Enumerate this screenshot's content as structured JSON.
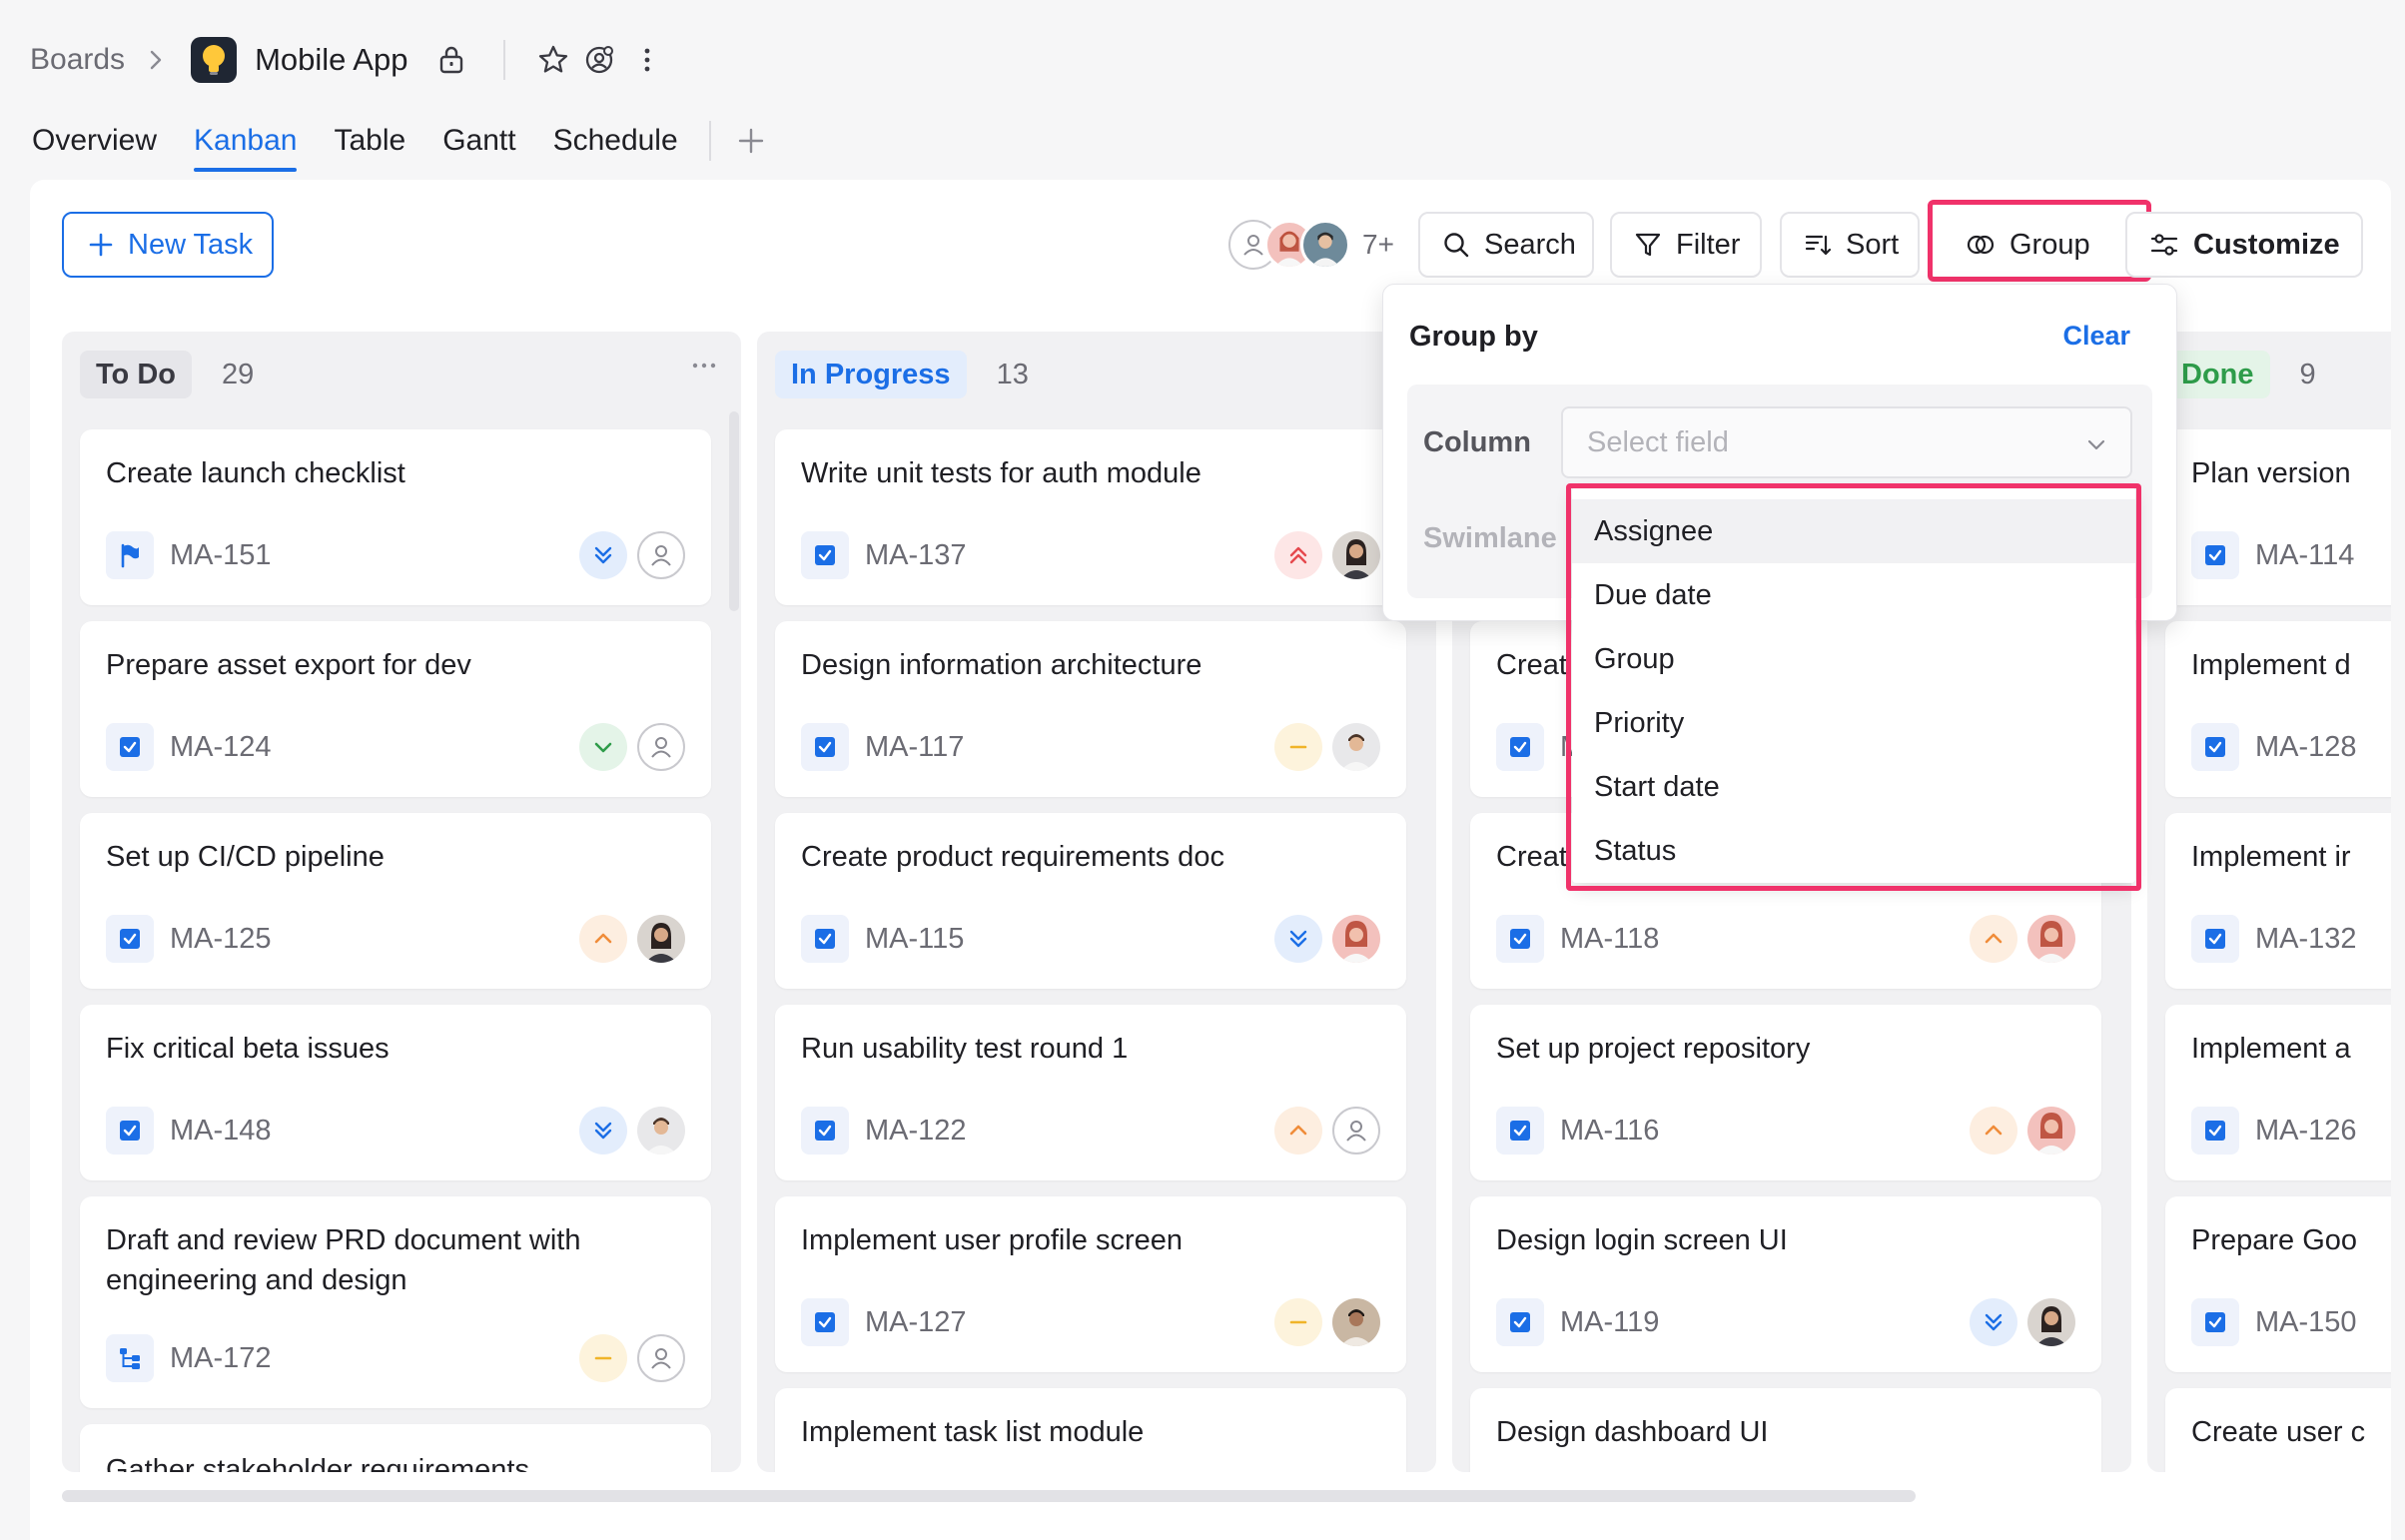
{
  "breadcrumb": {
    "root": "Boards",
    "app_name": "Mobile App"
  },
  "tabs": [
    "Overview",
    "Kanban",
    "Table",
    "Gantt",
    "Schedule"
  ],
  "active_tab": "Kanban",
  "toolbar": {
    "new_task": "New Task",
    "members_more": "7+",
    "search": "Search",
    "filter": "Filter",
    "sort": "Sort",
    "group": "Group",
    "customize": "Customize"
  },
  "columns": [
    {
      "name": "To Do",
      "count": "29",
      "accent": "#3a3a42",
      "chip_bg": "#e6e6ea",
      "cards": [
        {
          "title": "Create launch checklist",
          "id": "MA-151",
          "type": "flag",
          "priority": "lowest",
          "assignee": "none"
        },
        {
          "title": "Prepare asset export for dev",
          "id": "MA-124",
          "type": "task",
          "priority": "low",
          "assignee": "none"
        },
        {
          "title": "Set up CI/CD pipeline",
          "id": "MA-125",
          "type": "task",
          "priority": "high",
          "assignee": "woman-dark"
        },
        {
          "title": "Fix critical beta issues",
          "id": "MA-148",
          "type": "task",
          "priority": "lowest",
          "assignee": "man-light"
        },
        {
          "title": "Draft and review PRD document with engineering and design",
          "id": "MA-172",
          "type": "subtask",
          "priority": "medium",
          "assignee": "none"
        },
        {
          "title": "Gather stakeholder requirements",
          "id": "",
          "type": "task",
          "priority": "",
          "assignee": ""
        }
      ]
    },
    {
      "name": "In Progress",
      "count": "13",
      "accent": "#1b6ee6",
      "chip_bg": "#e3edfc",
      "cards": [
        {
          "title": "Write unit tests for auth module",
          "id": "MA-137",
          "type": "task",
          "priority": "highest",
          "assignee": "woman-dark"
        },
        {
          "title": "Design information architecture",
          "id": "MA-117",
          "type": "task",
          "priority": "medium",
          "assignee": "man-light"
        },
        {
          "title": "Create product requirements doc",
          "id": "MA-115",
          "type": "task",
          "priority": "lowest",
          "assignee": "woman-red"
        },
        {
          "title": "Run usability test round 1",
          "id": "MA-122",
          "type": "task",
          "priority": "high",
          "assignee": "none"
        },
        {
          "title": "Implement user profile screen",
          "id": "MA-127",
          "type": "task",
          "priority": "medium",
          "assignee": "man-dark"
        },
        {
          "title": "Implement task list module",
          "id": "",
          "type": "task",
          "priority": "",
          "assignee": ""
        }
      ]
    },
    {
      "name": "",
      "count": "",
      "accent": "#1f1f24",
      "chip_bg": "#ffffff",
      "cards": [
        {
          "title": "",
          "id": "",
          "type": "task",
          "priority": "",
          "assignee": ""
        },
        {
          "title": "Creat",
          "id": "M",
          "type": "task",
          "priority": "",
          "assignee": ""
        },
        {
          "title": "Creat",
          "id": "MA-118",
          "type": "task",
          "priority": "high",
          "assignee": "woman-red"
        },
        {
          "title": "Set up project repository",
          "id": "MA-116",
          "type": "task",
          "priority": "high",
          "assignee": "woman-red"
        },
        {
          "title": "Design login screen UI",
          "id": "MA-119",
          "type": "task",
          "priority": "lowest",
          "assignee": "woman-dark"
        },
        {
          "title": "Design dashboard UI",
          "id": "",
          "type": "task",
          "priority": "",
          "assignee": ""
        }
      ]
    },
    {
      "name": "Done",
      "count": "9",
      "accent": "#2e9c4a",
      "chip_bg": "#e4f4e8",
      "cards": [
        {
          "title": "Plan version",
          "id": "MA-114",
          "type": "task",
          "priority": "",
          "assignee": ""
        },
        {
          "title": "Implement d",
          "id": "MA-128",
          "type": "task",
          "priority": "",
          "assignee": ""
        },
        {
          "title": "Implement ir",
          "id": "MA-132",
          "type": "task",
          "priority": "",
          "assignee": ""
        },
        {
          "title": "Implement a",
          "id": "MA-126",
          "type": "task",
          "priority": "",
          "assignee": ""
        },
        {
          "title": "Prepare Goo",
          "id": "MA-150",
          "type": "task",
          "priority": "",
          "assignee": ""
        },
        {
          "title": "Create user c",
          "id": "",
          "type": "task",
          "priority": "",
          "assignee": ""
        }
      ]
    }
  ],
  "group_popover": {
    "title": "Group by",
    "clear": "Clear",
    "column_label": "Column",
    "swimlane_label": "Swimlane",
    "select_placeholder": "Select field",
    "options": [
      "Assignee",
      "Due date",
      "Group",
      "Priority",
      "Start date",
      "Status"
    ],
    "hovered_option": "Assignee"
  },
  "colors": {
    "accent": "#1b6ee6",
    "highlight": "#f0326a",
    "priority_highest": "#e5484d",
    "priority_high": "#f08c3a",
    "priority_medium": "#f0b429",
    "priority_low": "#2e9c4a",
    "priority_lowest": "#1b6ee6"
  }
}
